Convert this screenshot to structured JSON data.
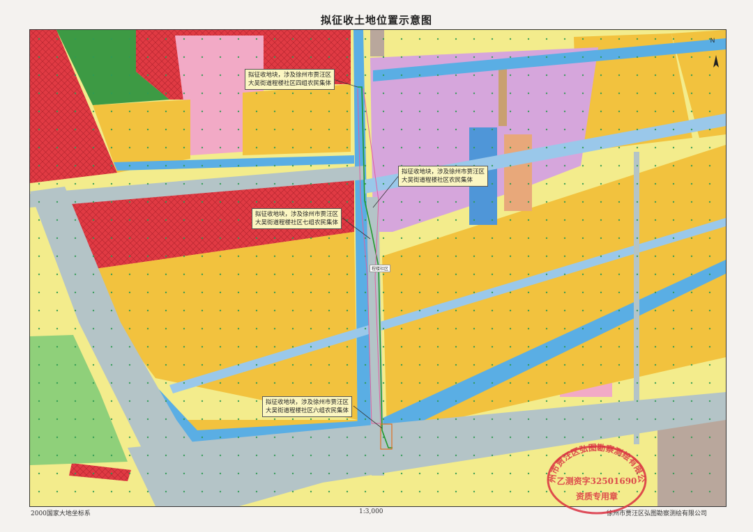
{
  "title": "拟征收土地位置示意图",
  "callouts": [
    {
      "line1": "拟征收地块，涉及徐州市贾汪区",
      "line2": "大吴街道程楼社区四组农民集体"
    },
    {
      "line1": "拟征收地块，涉及徐州市贾汪区",
      "line2": "大吴街道程楼社区农民集体"
    },
    {
      "line1": "拟征收地块，涉及徐州市贾汪区",
      "line2": "大吴街道程楼社区七组农民集体"
    },
    {
      "line1": "拟征收地块，涉及徐州市贾汪区",
      "line2": "大吴街道程楼社区六组农民集体"
    }
  ],
  "road_label": "程楼社区",
  "north_label": "N",
  "footer": {
    "coordinate_system": "2000国家大地坐标系",
    "scale": "1:3,000",
    "company": "徐州市贾汪区弘图勘察测绘有限公司"
  },
  "stamp": {
    "ring_text": "徐州市贾汪区弘图勘察测绘有限公司",
    "cert": "乙测资字32501690",
    "seal_type": "资质专用章",
    "color": "#d93040"
  },
  "colors": {
    "residential_red": "#e03a43",
    "commercial_pink": "#f2aac6",
    "industrial_purple": "#d6a6dc",
    "farmland_yellow": "#f2c23e",
    "water_blue": "#5aaee4",
    "road_gray": "#b4c4c7",
    "green": "#3d9a44",
    "light_green": "#8fd07a",
    "pale_yellow": "#f3ec8c",
    "brown": "#b9a79c",
    "boundary_green": "#1f9a2a",
    "boundary_pink": "#e060a0"
  }
}
